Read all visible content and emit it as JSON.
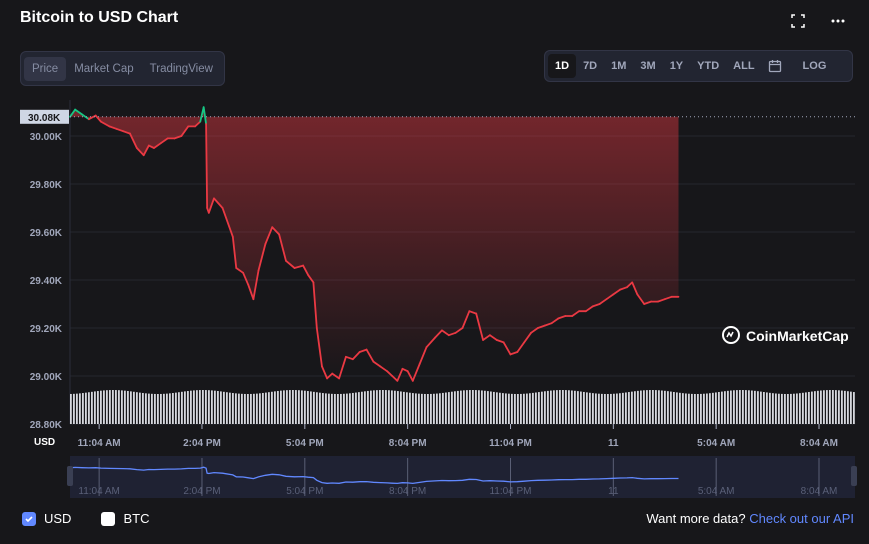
{
  "title": "Bitcoin to USD Chart",
  "top_icons": [
    "fullscreen-icon",
    "more-icon"
  ],
  "view_tabs": [
    {
      "label": "Price",
      "active": true
    },
    {
      "label": "Market Cap",
      "active": false
    },
    {
      "label": "TradingView",
      "active": false
    }
  ],
  "range_tabs": [
    {
      "label": "1D",
      "active": true
    },
    {
      "label": "7D",
      "active": false
    },
    {
      "label": "1M",
      "active": false
    },
    {
      "label": "3M",
      "active": false
    },
    {
      "label": "1Y",
      "active": false
    },
    {
      "label": "YTD",
      "active": false
    },
    {
      "label": "ALL",
      "active": false
    }
  ],
  "calendar_icon": "calendar-icon",
  "log_label": "LOG",
  "current_price_label": "30.08K",
  "currency_label": "USD",
  "watermark": "CoinMarketCap",
  "legend": [
    {
      "label": "USD",
      "checked": true
    },
    {
      "label": "BTC",
      "checked": false
    }
  ],
  "footer": {
    "text": "Want more data?",
    "link": "Check out our API"
  },
  "colors": {
    "up": "#16c784",
    "down": "#ea3943",
    "accent": "#6188ff",
    "background": "#17171a"
  },
  "chart_data": {
    "type": "line",
    "ylim": [
      28800,
      30150
    ],
    "y_ticks": [
      "30.00K",
      "29.80K",
      "29.60K",
      "29.40K",
      "29.20K",
      "29.00K",
      "28.80K"
    ],
    "y_tick_values": [
      30000,
      29800,
      29600,
      29400,
      29200,
      29000,
      28800
    ],
    "x_ticks": [
      "11:04 AM",
      "2:04 PM",
      "5:04 PM",
      "8:04 PM",
      "11:04 PM",
      "11",
      "5:04 AM",
      "8:04 AM"
    ],
    "x_tick_values": [
      1,
      4,
      7,
      10,
      13,
      16,
      19,
      22
    ],
    "xlim": [
      0.15,
      23.05
    ],
    "reference_price": 30080,
    "series": [
      {
        "values": [
          [
            0.15,
            30080
          ],
          [
            0.3,
            30110
          ],
          [
            0.5,
            30090
          ],
          [
            0.7,
            30070
          ],
          [
            0.9,
            30085
          ],
          [
            1.05,
            30060
          ],
          [
            1.3,
            30040
          ],
          [
            1.5,
            30030
          ],
          [
            1.7,
            30020
          ],
          [
            1.9,
            30010
          ],
          [
            2.1,
            29950
          ],
          [
            2.3,
            29920
          ],
          [
            2.45,
            29960
          ],
          [
            2.6,
            29950
          ],
          [
            2.8,
            29970
          ],
          [
            3.0,
            29990
          ],
          [
            3.2,
            29990
          ],
          [
            3.4,
            30000
          ],
          [
            3.6,
            30040
          ],
          [
            3.8,
            30040
          ],
          [
            3.95,
            30060
          ],
          [
            4.05,
            30120
          ],
          [
            4.12,
            30050
          ],
          [
            4.15,
            29700
          ],
          [
            4.2,
            29680
          ],
          [
            4.35,
            29740
          ],
          [
            4.6,
            29700
          ],
          [
            4.9,
            29580
          ],
          [
            5.0,
            29450
          ],
          [
            5.2,
            29430
          ],
          [
            5.35,
            29380
          ],
          [
            5.5,
            29320
          ],
          [
            5.65,
            29440
          ],
          [
            5.85,
            29550
          ],
          [
            6.05,
            29620
          ],
          [
            6.25,
            29590
          ],
          [
            6.45,
            29480
          ],
          [
            6.7,
            29450
          ],
          [
            6.95,
            29460
          ],
          [
            7.1,
            29420
          ],
          [
            7.25,
            29390
          ],
          [
            7.35,
            29200
          ],
          [
            7.5,
            29040
          ],
          [
            7.65,
            28990
          ],
          [
            7.8,
            29010
          ],
          [
            8.0,
            28990
          ],
          [
            8.2,
            29080
          ],
          [
            8.4,
            29070
          ],
          [
            8.6,
            29100
          ],
          [
            8.8,
            29110
          ],
          [
            9.0,
            29060
          ],
          [
            9.2,
            29040
          ],
          [
            9.4,
            29020
          ],
          [
            9.55,
            29000
          ],
          [
            9.7,
            28980
          ],
          [
            9.85,
            29030
          ],
          [
            10.0,
            29020
          ],
          [
            10.15,
            28980
          ],
          [
            10.35,
            29050
          ],
          [
            10.55,
            29120
          ],
          [
            10.8,
            29160
          ],
          [
            11.0,
            29190
          ],
          [
            11.2,
            29170
          ],
          [
            11.4,
            29180
          ],
          [
            11.6,
            29200
          ],
          [
            11.8,
            29270
          ],
          [
            12.0,
            29260
          ],
          [
            12.2,
            29150
          ],
          [
            12.4,
            29170
          ],
          [
            12.6,
            29150
          ],
          [
            12.8,
            29140
          ],
          [
            13.0,
            29090
          ],
          [
            13.2,
            29100
          ],
          [
            13.4,
            29140
          ],
          [
            13.6,
            29180
          ],
          [
            13.8,
            29200
          ],
          [
            14.0,
            29210
          ],
          [
            14.2,
            29220
          ],
          [
            14.4,
            29240
          ],
          [
            14.6,
            29250
          ],
          [
            14.8,
            29250
          ],
          [
            15.0,
            29270
          ],
          [
            15.2,
            29270
          ],
          [
            15.4,
            29290
          ],
          [
            15.6,
            29300
          ],
          [
            15.8,
            29320
          ],
          [
            16.0,
            29340
          ],
          [
            16.2,
            29360
          ],
          [
            16.4,
            29370
          ],
          [
            16.55,
            29390
          ],
          [
            16.7,
            29340
          ],
          [
            16.9,
            29300
          ],
          [
            17.1,
            29310
          ],
          [
            17.3,
            29310
          ],
          [
            17.5,
            29320
          ],
          [
            17.7,
            29330
          ],
          [
            17.9,
            29330
          ]
        ]
      }
    ],
    "navigator_x_ticks": [
      "11:04 AM",
      "2:04 PM",
      "5:04 PM",
      "8:04 PM",
      "11:04 PM",
      "11",
      "5:04 AM",
      "8:04 AM"
    ]
  }
}
